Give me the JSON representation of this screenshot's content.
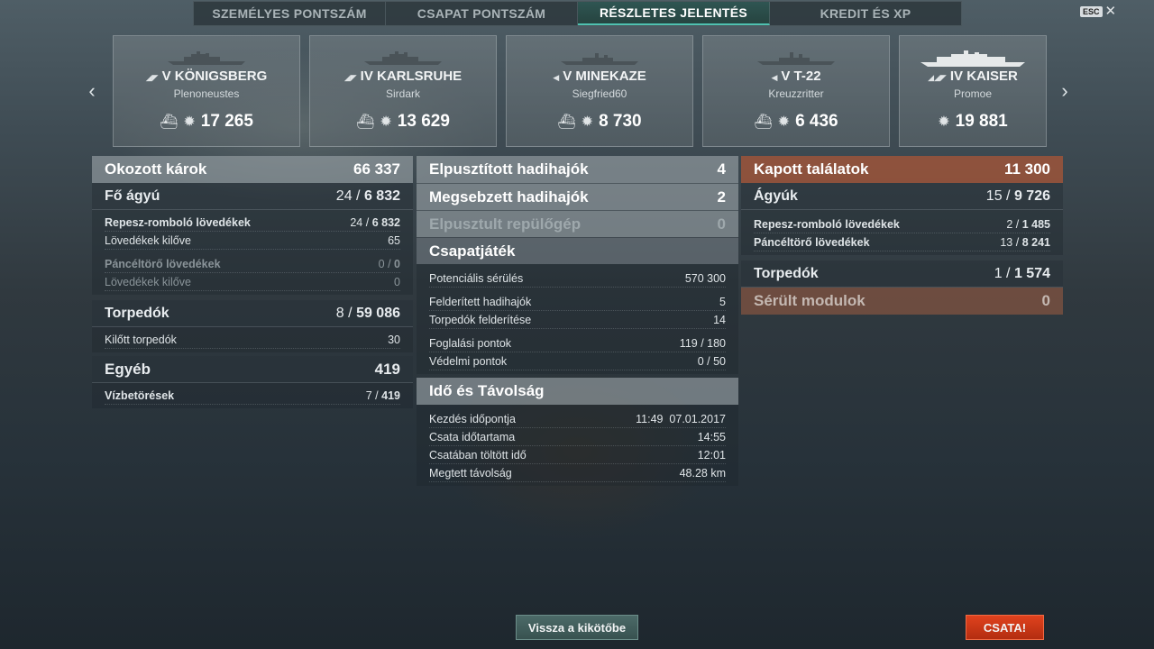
{
  "tabs": [
    {
      "label": "SZEMÉLYES PONTSZÁM"
    },
    {
      "label": "CSAPAT PONTSZÁM"
    },
    {
      "label": "RÉSZLETES JELENTÉS"
    },
    {
      "label": "KREDIT ÉS XP"
    }
  ],
  "esc": {
    "key": "ESC",
    "close": "✕"
  },
  "nav": {
    "prev": "‹",
    "next": "›"
  },
  "ships": [
    {
      "tier": "V",
      "name": "KÖNIGSBERG",
      "player": "Plenoneustes",
      "damage": "17 265"
    },
    {
      "tier": "IV",
      "name": "KARLSRUHE",
      "player": "Sirdark",
      "damage": "13 629"
    },
    {
      "tier": "V",
      "name": "MINEKAZE",
      "player": "Siegfried60",
      "damage": "8 730"
    },
    {
      "tier": "V",
      "name": "T-22",
      "player": "Kreuzzritter",
      "damage": "6 436"
    },
    {
      "tier": "IV",
      "name": "KAISER",
      "player": "Promoe",
      "damage": "19 881"
    }
  ],
  "left": {
    "damage": {
      "label": "Okozott károk",
      "value": "66 337"
    },
    "main": {
      "label": "Fő ágyú",
      "hits": "24",
      "sep": "/",
      "value": "6 832"
    },
    "he": {
      "label": "Repesz-romboló lövedékek",
      "hits": "24",
      "sep": "/",
      "value": "6 832"
    },
    "he_fired": {
      "label": "Lövedékek kilőve",
      "value": "65"
    },
    "ap": {
      "label": "Páncéltörő lövedékek",
      "hits": "0",
      "sep": "/",
      "value": "0"
    },
    "ap_fired": {
      "label": "Lövedékek kilőve",
      "value": "0"
    },
    "torp": {
      "label": "Torpedók",
      "hits": "8",
      "sep": "/",
      "value": "59 086"
    },
    "torp_fired": {
      "label": "Kilőtt torpedók",
      "value": "30"
    },
    "other": {
      "label": "Egyéb",
      "value": "419"
    },
    "flood": {
      "label": "Vízbetörések",
      "hits": "7",
      "sep": "/",
      "value": "419"
    }
  },
  "mid": {
    "destroyed": {
      "label": "Elpusztított hadihajók",
      "value": "4"
    },
    "damaged": {
      "label": "Megsebzett hadihajók",
      "value": "2"
    },
    "planes": {
      "label": "Elpusztult repülőgép",
      "value": "0"
    },
    "team": {
      "label": "Csapatjáték"
    },
    "potential": {
      "label": "Potenciális sérülés",
      "value": "570 300"
    },
    "spotted": {
      "label": "Felderített hadihajók",
      "value": "5"
    },
    "torp_spot": {
      "label": "Torpedók felderítése",
      "value": "14"
    },
    "capture": {
      "label": "Foglalási pontok",
      "value": "119 / 180"
    },
    "defense": {
      "label": "Védelmi pontok",
      "value": "0 / 50"
    },
    "time": {
      "label": "Idő és Távolság"
    },
    "start": {
      "label": "Kezdés időpontja",
      "value": "11:49  07.01.2017"
    },
    "duration": {
      "label": "Csata időtartama",
      "value": "14:55"
    },
    "in_battle": {
      "label": "Csatában töltött idő",
      "value": "12:01"
    },
    "distance": {
      "label": "Megtett távolság",
      "value": "48.28 km"
    }
  },
  "right": {
    "received": {
      "label": "Kapott találatok",
      "value": "11 300"
    },
    "guns": {
      "label": "Ágyúk",
      "hits": "15",
      "sep": "/",
      "value": "9 726"
    },
    "he": {
      "label": "Repesz-romboló lövedékek",
      "hits": "2",
      "sep": "/",
      "value": "1 485"
    },
    "ap": {
      "label": "Páncéltörő lövedékek",
      "hits": "13",
      "sep": "/",
      "value": "8 241"
    },
    "torp": {
      "label": "Torpedók",
      "hits": "1",
      "sep": "/",
      "value": "1 574"
    },
    "modules": {
      "label": "Sérült modulok",
      "value": "0"
    }
  },
  "buttons": {
    "back": "Vissza a kikötőbe",
    "battle": "CSATA!"
  },
  "colors": {
    "active_tab": "#2f5552",
    "received_header": "#aa5537",
    "battle_button": "#e0421e"
  }
}
